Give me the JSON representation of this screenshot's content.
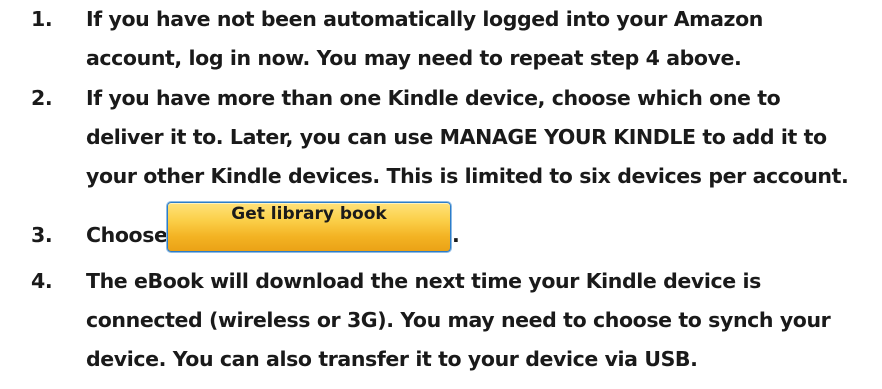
{
  "steps": [
    {
      "number": "1.",
      "lines": [
        "If you have not been automatically logged into your Amazon",
        "account, log in now. You may need to repeat step 4 above."
      ]
    },
    {
      "number": "2.",
      "lines": [
        "If you have more than one Kindle device, choose which one to",
        "deliver it to.  Later, you can use MANAGE YOUR KINDLE to add it to",
        "your other Kindle devices. This is limited to six devices per account."
      ]
    },
    {
      "number": "3.",
      "prefix": "Choose",
      "button_label": "Get library book",
      "suffix": "."
    },
    {
      "number": "4.",
      "lines": [
        "The eBook will download the next time your Kindle device is",
        "connected (wireless or 3G). You may need to choose to synch your",
        "device. You can also transfer it to your device via USB."
      ]
    }
  ],
  "colors": {
    "text": "#1a1a1a",
    "button_top": "#ffe27a",
    "button_bottom": "#eba216",
    "button_border": "#2d7cc8"
  }
}
